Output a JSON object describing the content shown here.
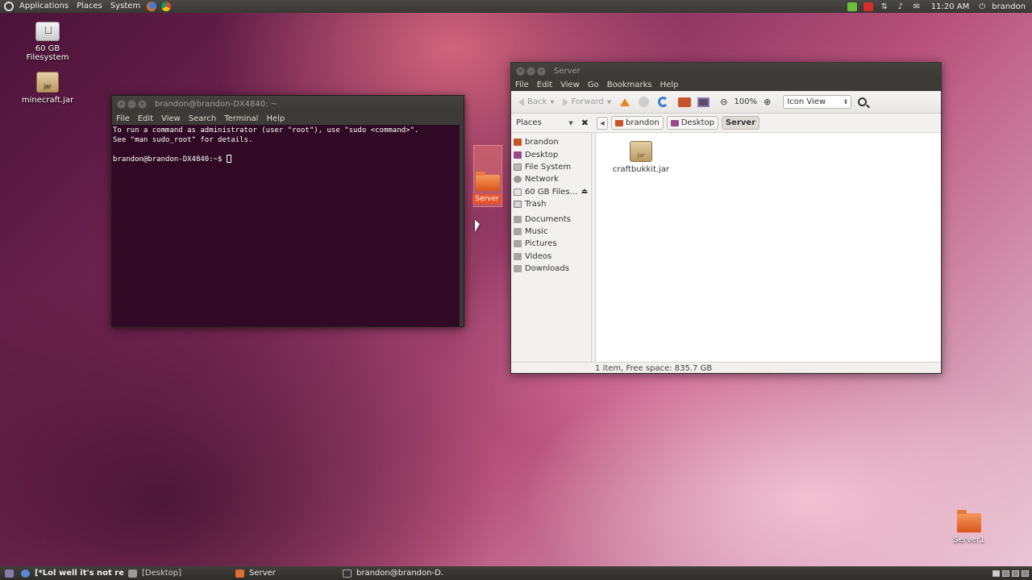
{
  "top_panel": {
    "menu": [
      "Applications",
      "Places",
      "System"
    ],
    "clock": "11:20 AM",
    "user": "brandon"
  },
  "desktop": {
    "icons": [
      {
        "label": "60 GB Filesystem",
        "icon": "drive-icon"
      },
      {
        "label": "minecraft.jar",
        "icon": "jar-icon",
        "badge": "jar"
      },
      {
        "label": "Server1",
        "icon": "folder-icon"
      }
    ],
    "drag_label": "Server"
  },
  "terminal": {
    "title": "brandon@brandon-DX4840: ~",
    "menu": [
      "File",
      "Edit",
      "View",
      "Search",
      "Terminal",
      "Help"
    ],
    "lines": [
      "To run a command as administrator (user \"root\"), use \"sudo <command>\".",
      "See \"man sudo_root\" for details.",
      "",
      "brandon@brandon-DX4840:~$ "
    ]
  },
  "file_manager": {
    "title": "Server",
    "menu": [
      "File",
      "Edit",
      "View",
      "Go",
      "Bookmarks",
      "Help"
    ],
    "toolbar": {
      "back": "Back",
      "forward": "Forward",
      "zoom": "100%",
      "view_mode": "Icon View"
    },
    "places_label": "Places",
    "breadcrumbs": [
      "brandon",
      "Desktop",
      "Server"
    ],
    "sidebar": {
      "group1": [
        "brandon",
        "Desktop",
        "File System",
        "Network",
        "60 GB Files…",
        "Trash"
      ],
      "group2": [
        "Documents",
        "Music",
        "Pictures",
        "Videos",
        "Downloads"
      ]
    },
    "files": [
      {
        "name": "craftbukkit.jar",
        "badge": "jar"
      }
    ],
    "status": "1 item, Free space: 835.7 GB"
  },
  "taskbar": {
    "tasks": [
      "[*Lol well it's not re...",
      "[Desktop]",
      "Server",
      "brandon@brandon-D..."
    ]
  }
}
